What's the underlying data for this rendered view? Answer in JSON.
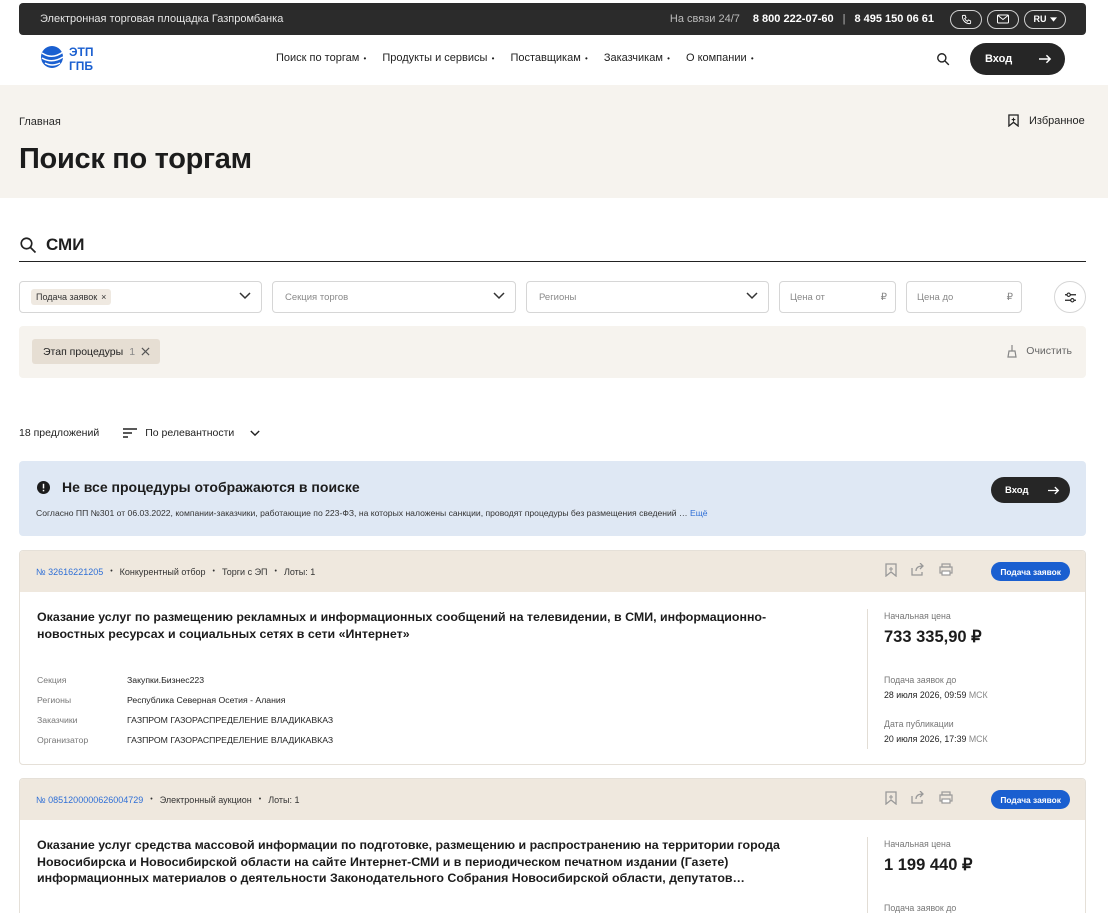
{
  "topbar": {
    "brand": "Электронная торговая площадка Газпромбанка",
    "support_label": "На связи 24/7",
    "phone1": "8 800 222-07-60",
    "separator": "|",
    "phone2": "8 495 150 06 61",
    "lang": "RU"
  },
  "header": {
    "logo_text_top": "ЭТП",
    "logo_text_bottom": "ГПБ",
    "nav": [
      "Поиск по торгам",
      "Продукты и сервисы",
      "Поставщикам",
      "Заказчикам",
      "О компании"
    ],
    "login_label": "Вход"
  },
  "hero": {
    "breadcrumb": "Главная",
    "favorites_label": "Избранное",
    "title": "Поиск по торгам"
  },
  "search": {
    "query": "СМИ"
  },
  "filters": {
    "stage_chip": "Подача заявок",
    "section_placeholder": "Секция торгов",
    "regions_placeholder": "Регионы",
    "price_from_placeholder": "Цена от",
    "price_to_placeholder": "Цена до",
    "currency": "₽"
  },
  "active_filters": {
    "chip_label": "Этап процедуры",
    "chip_count": "1",
    "clear_label": "Очистить"
  },
  "results": {
    "count_label": "18 предложений",
    "sort_label": "По релевантности"
  },
  "notice": {
    "title": "Не все процедуры отображаются в поиске",
    "text": "Согласно ПП №301 от 06.03.2022, компании-заказчики, работающие по 223-ФЗ, на которых наложены санкции, проводят процедуры без размещения сведений …",
    "more_label": "Ещё",
    "button_label": "Вход"
  },
  "cards": [
    {
      "number": "№ 32616221205",
      "tags": [
        "Конкурентный отбор",
        "Торги с ЭП",
        "Лоты: 1"
      ],
      "status": "Подача заявок",
      "title": "Оказание услуг по размещению рекламных и информационных сообщений на телевидении, в СМИ, информационно-новостных ресурсах и социальных сетях в сети «Интернет»",
      "meta": [
        {
          "k": "Секция",
          "v": "Закупки.Бизнес223"
        },
        {
          "k": "Регионы",
          "v": "Республика Северная Осетия - Алания"
        },
        {
          "k": "Заказчики",
          "v": "ГАЗПРОМ ГАЗОРАСПРЕДЕЛЕНИЕ ВЛАДИКАВКАЗ"
        },
        {
          "k": "Организатор",
          "v": "ГАЗПРОМ ГАЗОРАСПРЕДЕЛЕНИЕ ВЛАДИКАВКАЗ"
        }
      ],
      "price_label": "Начальная цена",
      "price": "733 335,90 ₽",
      "deadline_label": "Подача заявок до",
      "deadline": "28 июля 2026, 09:59",
      "published_label": "Дата публикации",
      "published": "20 июля 2026, 17:39",
      "tz": "МСК"
    },
    {
      "number": "№ 0851200000626004729",
      "tags": [
        "Электронный аукцион",
        "Лоты: 1"
      ],
      "status": "Подача заявок",
      "title": "Оказание услуг средства массовой информации по подготовке, размещению и распространению на территории города Новосибирска и Новосибирской области на сайте Интернет-СМИ и в периодическом печатном издании (Газете) информационных материалов о деятельности Законодательного Собрания Новосибирской области, депутатов…",
      "price_label": "Начальная цена",
      "price": "1 199 440 ₽",
      "deadline_label": "Подача заявок до"
    }
  ],
  "colors": {
    "dark": "#2b2b2b",
    "beige": "#f6f3ee",
    "card_header": "#efe8de",
    "notice_bg": "#dfe8f4",
    "link_blue": "#2f6fd6",
    "badge_blue": "#1a5fd0"
  }
}
